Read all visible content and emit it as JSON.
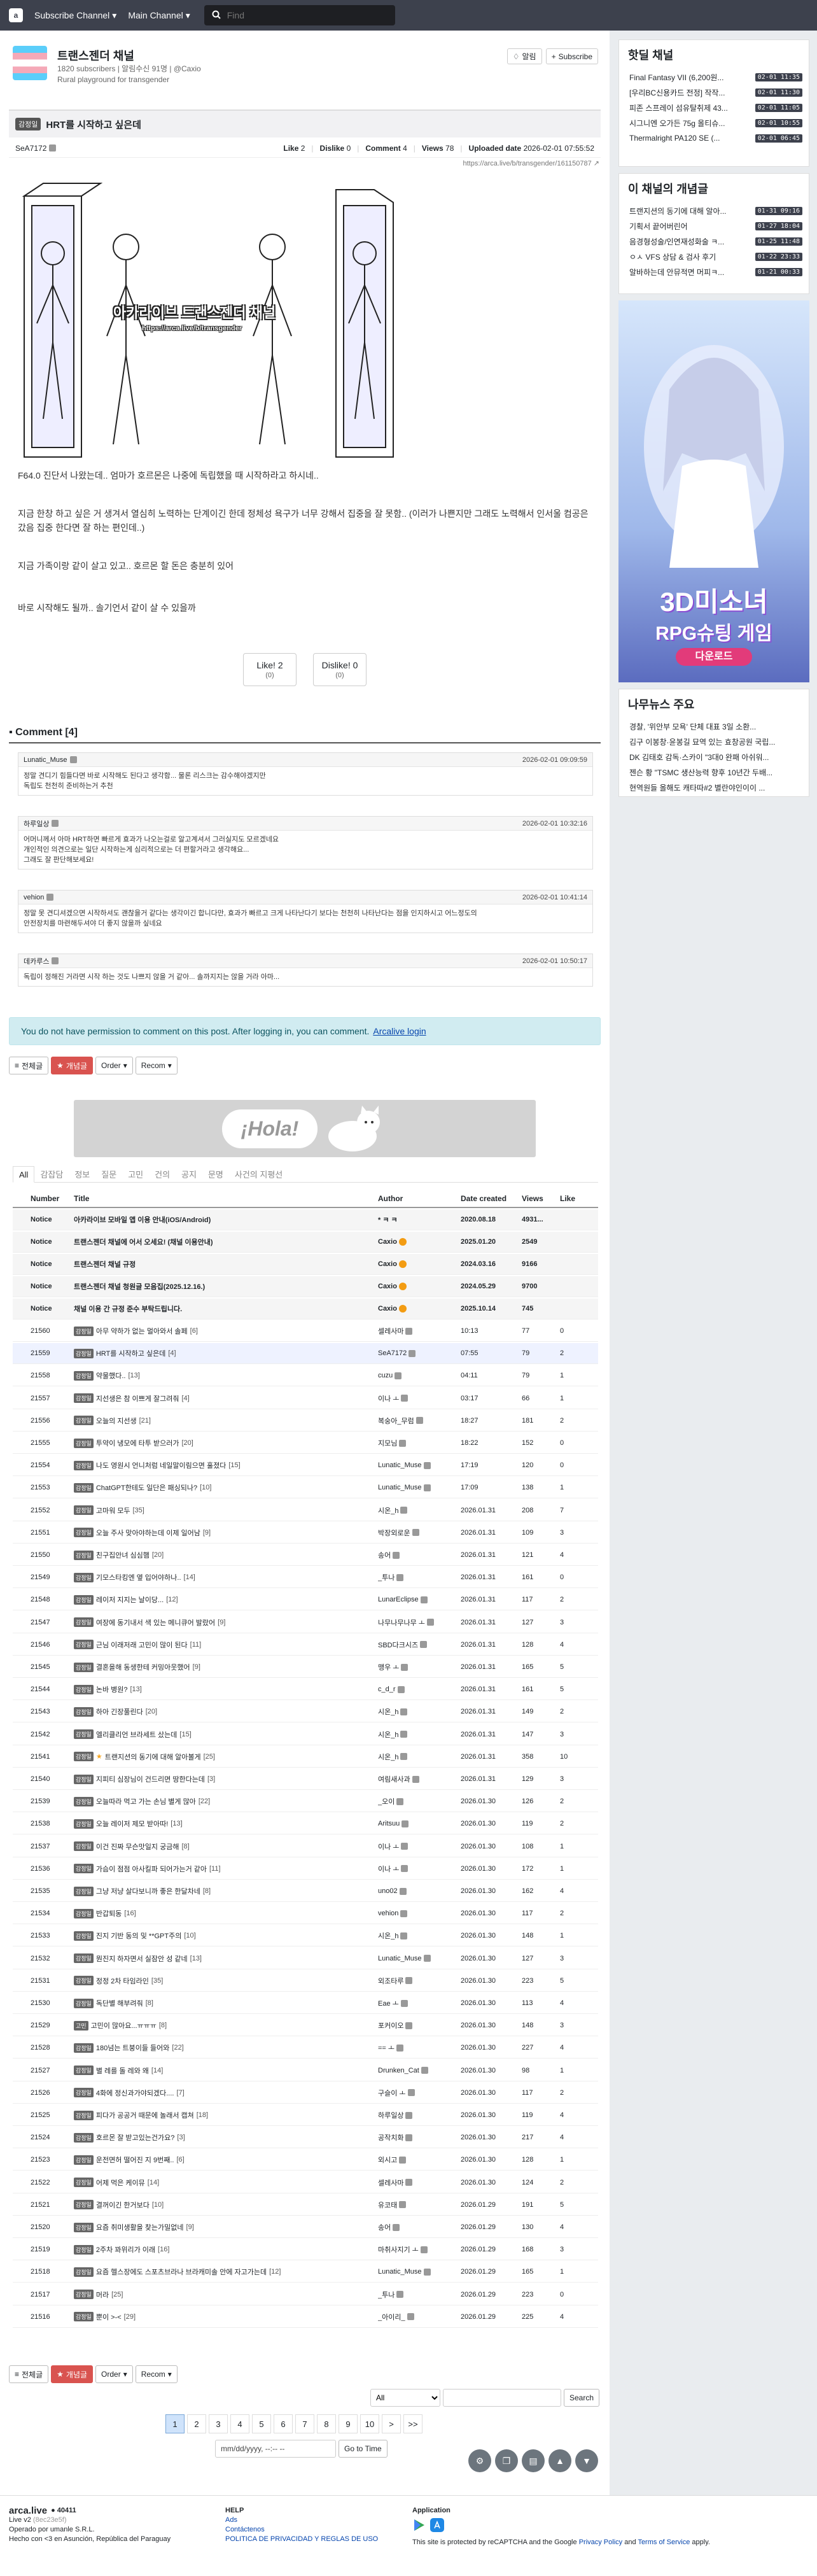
{
  "navbar": {
    "logo": "a",
    "subscribe_menu": "Subscribe Channel",
    "main_menu": "Main Channel",
    "search_placeholder": "Find"
  },
  "channel": {
    "name": "트랜스젠더 채널",
    "meta": "1820 subscribers | 알림수신 91명 | @Caxio",
    "description": "Rural playground for transgender",
    "notify_label": "알림",
    "subscribe_label": "Subscribe"
  },
  "article": {
    "category": "감정일",
    "title": "HRT를 시작하고 싶은데",
    "author": "SeA7172",
    "like_label": "Like",
    "like_count": "2",
    "dislike_label": "Dislike",
    "dislike_count": "0",
    "comment_label": "Comment",
    "comment_count": "4",
    "views_label": "Views",
    "views_count": "78",
    "uploaded_label": "Uploaded date",
    "uploaded_date": "2026-02-01 07:55:52",
    "link": "https://arca.live/b/transgender/161150787",
    "comic_caption_1": "아카라이브 트랜스젠더 채널",
    "comic_caption_2": "https://arca.live/b/transgender",
    "paragraphs": [
      "F64.0 진단서 나왔는데.. 엄마가 호르몬은 나중에 독립했을 때 시작하라고 하시네..",
      "지금 한창 하고 싶은 거 생겨서 열심히 노력하는 단계이긴 한데 정체성 욕구가 너무 강해서 집중을 잘 못함.. (이러가 나쁜지만 그래도 노력해서 인서울 컴공은 갔음 집중 한다면 잘 하는 편인데..)",
      "지금 가족이랑 같이 살고 있고.. 호르몬 할 돈은 충분히 있어",
      "바로 시작해도 될까.. 솔기언서 같이 살 수 있을까"
    ],
    "vote_like": "Like!",
    "vote_like_count": "2",
    "vote_like_sub": "(0)",
    "vote_dislike": "Dislike!",
    "vote_dislike_count": "0",
    "vote_dislike_sub": "(0)"
  },
  "comments": {
    "header": "Comment [4]",
    "items": [
      {
        "author": "Lunatic_Muse",
        "time": "2026-02-01 09:09:59",
        "text": "정말 견디기 힘들다면 바로 시작해도 된다고 생각함... 물론 리스크는 감수해야겠지만\n독립도 천천히 준비하는거 추천"
      },
      {
        "author": "하루일상",
        "time": "2026-02-01 10:32:16",
        "text": "어머니께서 아마 HRT하면 빠르게 효과가 나오는걸로 알고계셔서 그러실지도 모르겠네요\n개인적인 의견으로는 일단 시작하는게 심리적으로는 더 편할거라고 생각해요...\n그래도 잘 판단해보세요!"
      },
      {
        "author": "vehion",
        "time": "2026-02-01 10:41:14",
        "text": "정말 못 견디셔겠으면 시작하셔도 괜찮을거 같다는 생각이긴 합니다만, 효과가 빠르고 크게 나타난다기 보다는 천천히 나타난다는 점을 인지하시고 어느정도의\n안전장치를 마련해두셔야 더 좋지 않을까 싶네요"
      },
      {
        "author": "데카루스",
        "time": "2026-02-01 10:50:17",
        "text": "독립이 정해진 거라면 시작 하는 것도 나쁘지 않을 거 같아... 솔까지지는 않을 거라 아마..."
      }
    ],
    "no_permission": "You do not have permission to comment on this post. After logging in, you can comment.",
    "login_link": "Arcalive login"
  },
  "controls": {
    "all": "전체글",
    "best": "개념글",
    "order": "Order",
    "recom": "Recom"
  },
  "banner": {
    "text": "¡Hola!"
  },
  "tabs": [
    "All",
    "감잡담",
    "정보",
    "질문",
    "고민",
    "건의",
    "공지",
    "문명",
    "사건의 지평선"
  ],
  "table": {
    "headers": {
      "number": "Number",
      "title": "Title",
      "author": "Author",
      "date": "Date created",
      "views": "Views",
      "like": "Like"
    },
    "notices": [
      {
        "num": "Notice",
        "title": "아카라이브 모바일 앱 이용 안내(iOS/Android)",
        "cnt": "",
        "author": "* ㅋ ㅋ",
        "date": "2020.08.18",
        "views": "4931...",
        "like": ""
      },
      {
        "num": "Notice",
        "title": "트랜스젠더 채널에 어서 오세요! (채널 이용안내)",
        "cnt": "",
        "author": "Caxio",
        "date": "2025.01.20",
        "views": "2549",
        "like": ""
      },
      {
        "num": "Notice",
        "title": "트랜스젠더 채널 규정",
        "cnt": "",
        "author": "Caxio",
        "date": "2024.03.16",
        "views": "9166",
        "like": ""
      },
      {
        "num": "Notice",
        "title": "트랜스젠더 채널 청원글 모음집(2025.12.16.)",
        "cnt": "",
        "author": "Caxio",
        "date": "2024.05.29",
        "views": "9700",
        "like": ""
      },
      {
        "num": "Notice",
        "title": "채널 이용 간 규정 준수 부탁드립니다.",
        "cnt": "",
        "author": "Caxio",
        "date": "2025.10.14",
        "views": "745",
        "like": ""
      }
    ],
    "rows": [
      {
        "num": "21560",
        "cat": "감정일",
        "title": "아무 약하가 없는 멀아와서 솔페",
        "cnt": "[6]",
        "author": "셀레사마",
        "date": "10:13",
        "views": "77",
        "like": "0"
      },
      {
        "num": "21559",
        "cat": "감정일",
        "title": "HRT를 시작하고 싶은데",
        "cnt": "[4]",
        "author": "SeA7172",
        "date": "07:55",
        "views": "79",
        "like": "2"
      },
      {
        "num": "21558",
        "cat": "감정일",
        "title": "약물했다..",
        "cnt": "[13]",
        "author": "cuzu",
        "date": "04:11",
        "views": "79",
        "like": "1"
      },
      {
        "num": "21557",
        "cat": "감정일",
        "title": "지선생은 참 이쁘게 잘그려줘",
        "cnt": "[4]",
        "author": "이나 ㅗ",
        "date": "03:17",
        "views": "66",
        "like": "1"
      },
      {
        "num": "21556",
        "cat": "감정일",
        "title": "오늘의 지선생",
        "cnt": "[21]",
        "author": "복숭아_무럼",
        "date": "18:27",
        "views": "181",
        "like": "2"
      },
      {
        "num": "21555",
        "cat": "감정일",
        "title": "투약이 냉모에 타투 받으러가",
        "cnt": "[20]",
        "author": "지모님",
        "date": "18:22",
        "views": "152",
        "like": "0"
      },
      {
        "num": "21554",
        "cat": "감정일",
        "title": "나도 영원시 언니처럼 네일말이림으면 훌졌다",
        "cnt": "[15]",
        "author": "Lunatic_Muse",
        "date": "17:19",
        "views": "120",
        "like": "0"
      },
      {
        "num": "21553",
        "cat": "감정일",
        "title": "ChatGPT한테도 일단은 패싱되나?",
        "cnt": "[10]",
        "author": "Lunatic_Muse",
        "date": "17:09",
        "views": "138",
        "like": "1"
      },
      {
        "num": "21552",
        "cat": "감정일",
        "title": "고마워 모두",
        "cnt": "[35]",
        "author": "시온_h",
        "date": "2026.01.31",
        "views": "208",
        "like": "7"
      },
      {
        "num": "21551",
        "cat": "감정일",
        "title": "오늘 주사 맞아야하는데 이제 일어남",
        "cnt": "[9]",
        "author": "박장외로운",
        "date": "2026.01.31",
        "views": "109",
        "like": "3"
      },
      {
        "num": "21550",
        "cat": "감정일",
        "title": "친구집안녀 심심햄",
        "cnt": "[20]",
        "author": "송어",
        "date": "2026.01.31",
        "views": "121",
        "like": "4"
      },
      {
        "num": "21549",
        "cat": "감정일",
        "title": "기모스타킹엔 옆 입어야하나..",
        "cnt": "[14]",
        "author": "_투나",
        "date": "2026.01.31",
        "views": "161",
        "like": "0"
      },
      {
        "num": "21548",
        "cat": "감정일",
        "title": "레이저 지지는 날이당...",
        "cnt": "[12]",
        "author": "LunarEclipse",
        "date": "2026.01.31",
        "views": "117",
        "like": "2"
      },
      {
        "num": "21547",
        "cat": "감정일",
        "title": "여장에 동기내서 색 있는 메니큐어 발랐어",
        "cnt": "[9]",
        "author": "나무나무나무 ㅗ",
        "date": "2026.01.31",
        "views": "127",
        "like": "3"
      },
      {
        "num": "21546",
        "cat": "감정일",
        "title": "근님 이래저래 고민이 많이 된다",
        "cnt": "[11]",
        "author": "SBD다크시즈",
        "date": "2026.01.31",
        "views": "128",
        "like": "4"
      },
      {
        "num": "21545",
        "cat": "감정일",
        "title": "결혼을해 동생한테 커밍아웃했어",
        "cnt": "[9]",
        "author": "맹우 ㅗ",
        "date": "2026.01.31",
        "views": "165",
        "like": "5"
      },
      {
        "num": "21544",
        "cat": "감정일",
        "title": "논바 병원?",
        "cnt": "[13]",
        "author": "c_d_r",
        "date": "2026.01.31",
        "views": "161",
        "like": "5"
      },
      {
        "num": "21543",
        "cat": "감정일",
        "title": "하아 긴장풀린다",
        "cnt": "[20]",
        "author": "시온_h",
        "date": "2026.01.31",
        "views": "149",
        "like": "2"
      },
      {
        "num": "21542",
        "cat": "감정일",
        "title": "엘리클리언 브라세트 샀는데",
        "cnt": "[15]",
        "author": "시온_h",
        "date": "2026.01.31",
        "views": "147",
        "like": "3"
      },
      {
        "num": "21541",
        "cat": "감정일",
        "title": "트랜지션의 동기에 대해 알아볼게",
        "cnt": "[25]",
        "author": "시온_h",
        "date": "2026.01.31",
        "views": "358",
        "like": "10",
        "star": true
      },
      {
        "num": "21540",
        "cat": "감정일",
        "title": "지피티 심장님이 건드리면 땅한다는데",
        "cnt": "[3]",
        "author": "여림새사과",
        "date": "2026.01.31",
        "views": "129",
        "like": "3"
      },
      {
        "num": "21539",
        "cat": "감정일",
        "title": "오늘따라 먹고 가는 손님 별게 많아",
        "cnt": "[22]",
        "author": "_오이",
        "date": "2026.01.30",
        "views": "126",
        "like": "2"
      },
      {
        "num": "21538",
        "cat": "감정일",
        "title": "오늘 레이저 제모 받아따!",
        "cnt": "[13]",
        "author": "Aritsuu",
        "date": "2026.01.30",
        "views": "119",
        "like": "2"
      },
      {
        "num": "21537",
        "cat": "감정일",
        "title": "이건 진짜 무슨맛일지 궁금해",
        "cnt": "[8]",
        "author": "이나 ㅗ",
        "date": "2026.01.30",
        "views": "108",
        "like": "1"
      },
      {
        "num": "21536",
        "cat": "감정일",
        "title": "가슴이 점점 아사킬파 되어가는거 같아",
        "cnt": "[11]",
        "author": "이나 ㅗ",
        "date": "2026.01.30",
        "views": "172",
        "like": "1"
      },
      {
        "num": "21535",
        "cat": "감정일",
        "title": "그냥 저냥 살다보니까 좋은 한달차네",
        "cnt": "[8]",
        "author": "uno02",
        "date": "2026.01.30",
        "views": "162",
        "like": "4"
      },
      {
        "num": "21534",
        "cat": "감정일",
        "title": "반갑퇴동",
        "cnt": "[16]",
        "author": "vehion",
        "date": "2026.01.30",
        "views": "117",
        "like": "2"
      },
      {
        "num": "21533",
        "cat": "감정일",
        "title": "진지 기반 동의 및 **GPT주의",
        "cnt": "[10]",
        "author": "시온_h",
        "date": "2026.01.30",
        "views": "148",
        "like": "1"
      },
      {
        "num": "21532",
        "cat": "감정일",
        "title": "뭔진지 하자면서 실잠안 성 같네",
        "cnt": "[13]",
        "author": "Lunatic_Muse",
        "date": "2026.01.30",
        "views": "127",
        "like": "3"
      },
      {
        "num": "21531",
        "cat": "감정일",
        "title": "정정 2차 타임라인",
        "cnt": "[35]",
        "author": "외조타루",
        "date": "2026.01.30",
        "views": "223",
        "like": "5"
      },
      {
        "num": "21530",
        "cat": "감정일",
        "title": "독단별 해부려줘",
        "cnt": "[8]",
        "author": "Eae ㅗ",
        "date": "2026.01.30",
        "views": "113",
        "like": "4"
      },
      {
        "num": "21529",
        "cat": "고민",
        "title": "고민이 많아요...ㅠㅠㅠ",
        "cnt": "[8]",
        "author": "포커이오",
        "date": "2026.01.30",
        "views": "148",
        "like": "3"
      },
      {
        "num": "21528",
        "cat": "감정일",
        "title": "180넘는 트붕이들 들어와",
        "cnt": "[22]",
        "author": "== ㅗ",
        "date": "2026.01.30",
        "views": "227",
        "like": "4"
      },
      {
        "num": "21527",
        "cat": "감정일",
        "title": "별 레를 돌 레와 왜",
        "cnt": "[14]",
        "author": "Drunken_Cat",
        "date": "2026.01.30",
        "views": "98",
        "like": "1"
      },
      {
        "num": "21526",
        "cat": "감정일",
        "title": "4화에 정신과가야되겠다....",
        "cnt": "[7]",
        "author": "구슬이 ㅗ",
        "date": "2026.01.30",
        "views": "117",
        "like": "2"
      },
      {
        "num": "21525",
        "cat": "감정일",
        "title": "피다가 공공거 때문에 놀래서 캡쳐",
        "cnt": "[18]",
        "author": "하루일상",
        "date": "2026.01.30",
        "views": "119",
        "like": "4"
      },
      {
        "num": "21524",
        "cat": "감정일",
        "title": "호르몬 잘 받고있는건가요?",
        "cnt": "[3]",
        "author": "공작치화",
        "date": "2026.01.30",
        "views": "217",
        "like": "4"
      },
      {
        "num": "21523",
        "cat": "감정일",
        "title": "운전면허 떨어진 지 9번째..",
        "cnt": "[6]",
        "author": "외시고",
        "date": "2026.01.30",
        "views": "128",
        "like": "1"
      },
      {
        "num": "21522",
        "cat": "감정일",
        "title": "어제 먹은 케이뮤",
        "cnt": "[14]",
        "author": "셀레사마",
        "date": "2026.01.30",
        "views": "124",
        "like": "2"
      },
      {
        "num": "21521",
        "cat": "감정일",
        "title": "결꺼이긴 한거보다",
        "cnt": "[10]",
        "author": "유코태",
        "date": "2026.01.29",
        "views": "191",
        "like": "5"
      },
      {
        "num": "21520",
        "cat": "감정일",
        "title": "요즘 취미생활을 찾는가밀없네",
        "cnt": "[9]",
        "author": "송어",
        "date": "2026.01.29",
        "views": "130",
        "like": "4"
      },
      {
        "num": "21519",
        "cat": "감정일",
        "title": "2주차 꽈위리가 이래",
        "cnt": "[16]",
        "author": "마취사지기 ㅗ",
        "date": "2026.01.29",
        "views": "168",
        "like": "3"
      },
      {
        "num": "21518",
        "cat": "감정일",
        "title": "요즘 헬스장에도 스포츠브라나 브라캐미솔 안에 자고가는데",
        "cnt": "[12]",
        "author": "Lunatic_Muse",
        "date": "2026.01.29",
        "views": "165",
        "like": "1"
      },
      {
        "num": "21517",
        "cat": "감정일",
        "title": "머라",
        "cnt": "[25]",
        "author": "_투나",
        "date": "2026.01.29",
        "views": "223",
        "like": "0"
      },
      {
        "num": "21516",
        "cat": "감정일",
        "title": "뿐이 >-<",
        "cnt": "[29]",
        "author": "_아이리_",
        "date": "2026.01.29",
        "views": "225",
        "like": "4"
      }
    ]
  },
  "search": {
    "scope": "All",
    "button": "Search"
  },
  "pagination": {
    "pages": [
      "1",
      "2",
      "3",
      "4",
      "5",
      "6",
      "7",
      "8",
      "9",
      "10"
    ],
    "next": ">",
    "last": ">>"
  },
  "date_filter": {
    "placeholder": "mm/dd/yyyy, --:-- --",
    "button": "Go to Time"
  },
  "sidebar": {
    "hot_title": "핫딜 채널",
    "hot_items": [
      {
        "text": "Final Fantasy VII (6,200원...",
        "time": "02-01 11:35"
      },
      {
        "text": "[우리BC신용카드 전정] 작작...",
        "time": "02-01 11:30"
      },
      {
        "text": "피존 스프레이 섬유탈취제 43...",
        "time": "02-01 11:05"
      },
      {
        "text": "시그니엔 오가든 75g 올티슈...",
        "time": "02-01 10:55"
      },
      {
        "text": "Thermalright PA120 SE (...",
        "time": "02-01 06:45"
      }
    ],
    "best_title": "이 채널의 개념글",
    "best_items": [
      {
        "text": "트랜지션의 동기에 대해 알아...",
        "time": "01-31 09:16"
      },
      {
        "text": "기획서 끝어버린어",
        "time": "01-27 18:04"
      },
      {
        "text": "음경형성술/인연재성화술 ㅋ...",
        "time": "01-25 11:48"
      },
      {
        "text": "ㅇㅅ VFS 상담 & 검사 후기",
        "time": "01-22 23:33"
      },
      {
        "text": "알바하는데 안뮤적면 머피ㅋ...",
        "time": "01-21 00:33"
      }
    ],
    "ad_title": "3D미소녀",
    "ad_subtitle": "RPG슈팅 게임",
    "ad_button": "다운로드",
    "news_title": "나무뉴스 주요",
    "news_items": [
      "경찰, '위안부 모욕' 단체 대표 3일 소환...",
      "김구 이봉창·윤봉길 묘역 있는 효창공원 국립...",
      "DK 김태호 감독·스카이 \"3대0 완패 아쉬워...",
      "젠슨 황 \"TSMC 생산능력 향후 10년간 두배...",
      "현역원들 올해도 캐타따#2 별란야인이이 ..."
    ]
  },
  "footer": {
    "brand": "arca.live",
    "users": "40411",
    "version": "Live v2",
    "version_hash": "(8ec23e5f)",
    "operator": "Operado por umanle S.R.L.",
    "made": "Hecho con <3 en Asunción, República del Paraguay",
    "help_title": "HELP",
    "help_links": [
      "Ads",
      "Contáctenos",
      "POLITICA DE PRIVACIDAD Y REGLAS DE USO"
    ],
    "app_title": "Application",
    "recaptcha_text": "This site is protected by reCAPTCHA and the Google",
    "privacy": "Privacy Policy",
    "and": "and",
    "terms": "Terms of Service",
    "apply": "apply."
  }
}
